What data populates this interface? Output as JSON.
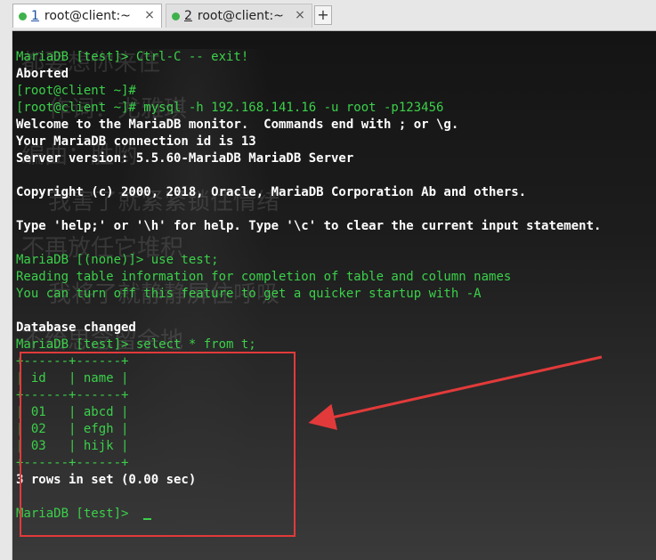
{
  "tabs": [
    {
      "number": "1",
      "title": "root@client:~",
      "active": true
    },
    {
      "number": "2",
      "title": "root@client:~",
      "active": false
    }
  ],
  "tab_close_glyph": "×",
  "new_tab_glyph": "+",
  "colors": {
    "prompt_green": "#3bd04a",
    "output_white": "#ffffff",
    "highlight_red": "#e23a3a"
  },
  "terminal": {
    "lines": [
      "MariaDB [test]> Ctrl-C -- exit!",
      "Aborted",
      "[root@client ~]#",
      "[root@client ~]# mysql -h 192.168.141.16 -u root -p123456",
      "Welcome to the MariaDB monitor.  Commands end with ; or \\g.",
      "Your MariaDB connection id is 13",
      "Server version: 5.5.60-MariaDB MariaDB Server",
      "",
      "Copyright (c) 2000, 2018, Oracle, MariaDB Corporation Ab and others.",
      "",
      "Type 'help;' or '\\h' for help. Type '\\c' to clear the current input statement.",
      "",
      "MariaDB [(none)]> use test;",
      "Reading table information for completion of table and column names",
      "You can turn off this feature to get a quicker startup with -A",
      "",
      "Database changed",
      "MariaDB [test]> select * from t;",
      "+------+------+",
      "| id   | name |",
      "+------+------+",
      "| 01   | abcd |",
      "| 02   | efgh |",
      "| 03   | hijk |",
      "+------+------+",
      "3 rows in set (0.00 sec)",
      "",
      "MariaDB [test]> "
    ],
    "line_styles": [
      "g",
      "w",
      "g",
      "g",
      "w",
      "w",
      "w",
      "g",
      "w",
      "g",
      "w",
      "g",
      "g",
      "g",
      "g",
      "g",
      "w",
      "g",
      "g",
      "g",
      "g",
      "g",
      "g",
      "g",
      "g",
      "w",
      "g",
      "g"
    ]
  },
  "wallpaper_text": [
    "都要想你来住",
    "作词：尤雅琪",
    "编曲：胜哟",
    "我害了就紧紧锁住情绪",
    "不再放任它堆积",
    "我将了就静静屏住呼吸",
    "不给思念留余地"
  ]
}
